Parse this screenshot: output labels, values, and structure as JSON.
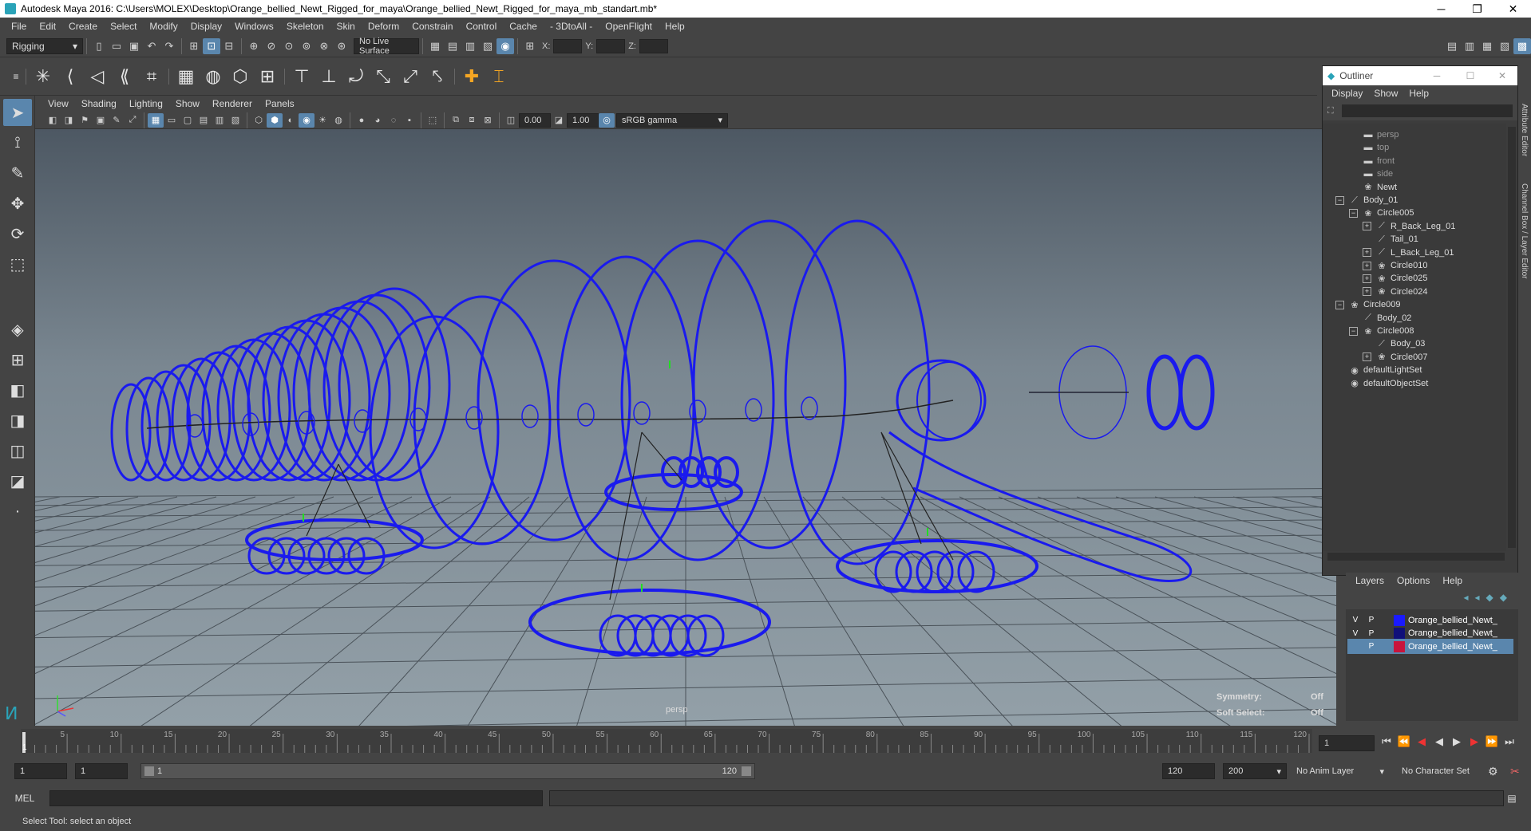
{
  "window": {
    "title": "Autodesk Maya 2016: C:\\Users\\MOLEX\\Desktop\\Orange_bellied_Newt_Rigged_for_maya\\Orange_bellied_Newt_Rigged_for_maya_mb_standart.mb*"
  },
  "menubar": [
    "File",
    "Edit",
    "Create",
    "Select",
    "Modify",
    "Display",
    "Windows",
    "Skeleton",
    "Skin",
    "Deform",
    "Constrain",
    "Control",
    "Cache",
    "- 3DtoAll -",
    "OpenFlight",
    "Help"
  ],
  "shelf": {
    "mode": "Rigging",
    "live_surface": "No Live Surface",
    "x_label": "X:",
    "y_label": "Y:",
    "z_label": "Z:"
  },
  "panel": {
    "menus": [
      "View",
      "Shading",
      "Lighting",
      "Show",
      "Renderer",
      "Panels"
    ],
    "exposure": "0.00",
    "gamma": "1.00",
    "color_space": "sRGB gamma",
    "camera": "persp",
    "symmetry_label": "Symmetry:",
    "symmetry_value": "Off",
    "soft_select_label": "Soft Select:",
    "soft_select_value": "Off"
  },
  "outliner": {
    "title": "Outliner",
    "menus": [
      "Display",
      "Show",
      "Help"
    ],
    "items": [
      {
        "label": "persp",
        "depth": 1,
        "expander": "",
        "icon": "camera-icon",
        "dim": true
      },
      {
        "label": "top",
        "depth": 1,
        "expander": "",
        "icon": "camera-icon",
        "dim": true
      },
      {
        "label": "front",
        "depth": 1,
        "expander": "",
        "icon": "camera-icon",
        "dim": true
      },
      {
        "label": "side",
        "depth": 1,
        "expander": "",
        "icon": "camera-icon",
        "dim": true
      },
      {
        "label": "Newt",
        "depth": 1,
        "expander": "",
        "icon": "curve-icon",
        "dim": false
      },
      {
        "label": "Body_01",
        "depth": 0,
        "expander": "−",
        "icon": "joint-icon",
        "dim": false
      },
      {
        "label": "Circle005",
        "depth": 1,
        "expander": "−",
        "icon": "curve-icon",
        "dim": false
      },
      {
        "label": "R_Back_Leg_01",
        "depth": 2,
        "expander": "+",
        "icon": "joint-icon",
        "dim": false
      },
      {
        "label": "Tail_01",
        "depth": 2,
        "expander": "",
        "icon": "joint-icon",
        "dim": false
      },
      {
        "label": "L_Back_Leg_01",
        "depth": 2,
        "expander": "+",
        "icon": "joint-icon",
        "dim": false
      },
      {
        "label": "Circle010",
        "depth": 2,
        "expander": "+",
        "icon": "curve-icon",
        "dim": false
      },
      {
        "label": "Circle025",
        "depth": 2,
        "expander": "+",
        "icon": "curve-icon",
        "dim": false
      },
      {
        "label": "Circle024",
        "depth": 2,
        "expander": "+",
        "icon": "curve-icon",
        "dim": false
      },
      {
        "label": "Circle009",
        "depth": 0,
        "expander": "−",
        "icon": "curve-icon",
        "dim": false
      },
      {
        "label": "Body_02",
        "depth": 1,
        "expander": "",
        "icon": "joint-icon",
        "dim": false
      },
      {
        "label": "Circle008",
        "depth": 1,
        "expander": "−",
        "icon": "curve-icon",
        "dim": false
      },
      {
        "label": "Body_03",
        "depth": 2,
        "expander": "",
        "icon": "joint-icon",
        "dim": false
      },
      {
        "label": "Circle007",
        "depth": 2,
        "expander": "+",
        "icon": "curve-icon",
        "dim": false
      },
      {
        "label": "defaultLightSet",
        "depth": 0,
        "expander": "",
        "icon": "set-icon",
        "dim": false
      },
      {
        "label": "defaultObjectSet",
        "depth": 0,
        "expander": "",
        "icon": "set-icon",
        "dim": false
      }
    ]
  },
  "layers": {
    "menus": [
      "Layers",
      "Options",
      "Help"
    ],
    "rows": [
      {
        "v": "V",
        "p": "P",
        "color": "#1a1aff",
        "name": "Orange_bellied_Newt_",
        "selected": false
      },
      {
        "v": "V",
        "p": "P",
        "color": "#10107a",
        "name": "Orange_bellied_Newt_",
        "selected": false
      },
      {
        "v": "",
        "p": "P",
        "color": "#c8143c",
        "name": "Orange_bellied_Newt_",
        "selected": true
      }
    ]
  },
  "side_tabs": [
    "Attribute Editor",
    "Channel Box / Layer Editor"
  ],
  "timeline": {
    "ticks": [
      "5",
      "10",
      "15",
      "20",
      "25",
      "30",
      "35",
      "40",
      "45",
      "50",
      "55",
      "60",
      "65",
      "70",
      "75",
      "80",
      "85",
      "90",
      "95",
      "100",
      "105",
      "110",
      "115",
      "120"
    ],
    "start_marker": "1",
    "current_frame": "1"
  },
  "range": {
    "start": "1",
    "start2": "1",
    "slider_start": "1",
    "slider_end": "120",
    "end": "120",
    "end2": "200",
    "anim_layer": "No Anim Layer",
    "char_set": "No Character Set"
  },
  "mel": {
    "label": "MEL"
  },
  "status": {
    "text": "Select Tool: select an object"
  },
  "colors": {
    "wire": "#1a1aee",
    "selection": "#5a86ad"
  }
}
